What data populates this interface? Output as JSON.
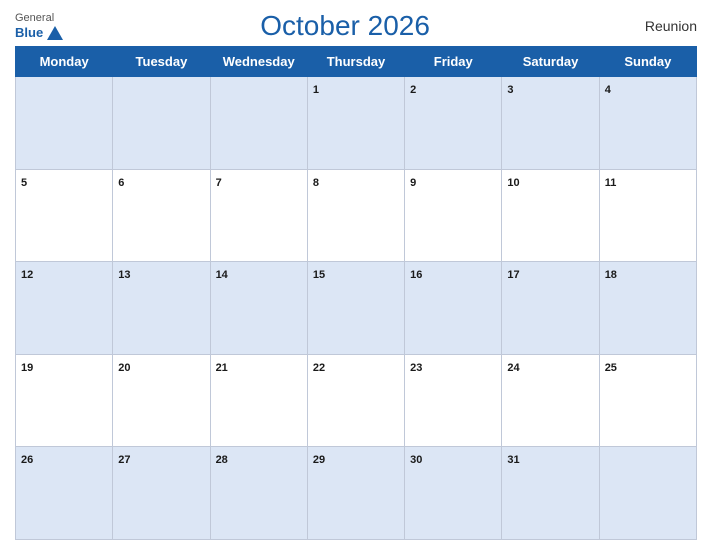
{
  "header": {
    "logo_general": "General",
    "logo_blue": "Blue",
    "title": "October 2026",
    "region": "Reunion"
  },
  "weekdays": [
    "Monday",
    "Tuesday",
    "Wednesday",
    "Thursday",
    "Friday",
    "Saturday",
    "Sunday"
  ],
  "weeks": [
    [
      null,
      null,
      null,
      1,
      2,
      3,
      4
    ],
    [
      5,
      6,
      7,
      8,
      9,
      10,
      11
    ],
    [
      12,
      13,
      14,
      15,
      16,
      17,
      18
    ],
    [
      19,
      20,
      21,
      22,
      23,
      24,
      25
    ],
    [
      26,
      27,
      28,
      29,
      30,
      31,
      null
    ]
  ]
}
